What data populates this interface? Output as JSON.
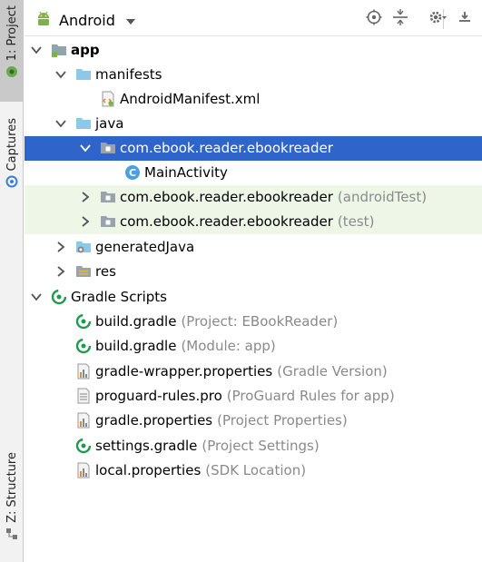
{
  "side_tabs": [
    {
      "label": "1: Project",
      "icon": "project-icon"
    },
    {
      "label": "Captures",
      "icon": "captures-icon"
    },
    {
      "label": "Z: Structure",
      "icon": "structure-icon"
    }
  ],
  "toolbar": {
    "view_label": "Android",
    "view_icon": "android-icon",
    "buttons": [
      "scroll-from-source-icon",
      "collapse-all-icon",
      "settings-icon",
      "hide-icon"
    ]
  },
  "tree": [
    {
      "label": "app",
      "bold": true,
      "hint": "",
      "icon": "module-folder-icon",
      "expanded": true
    },
    {
      "label": "manifests",
      "hint": "",
      "icon": "folder-icon",
      "expanded": true
    },
    {
      "label": "AndroidManifest.xml",
      "hint": "",
      "icon": "manifest-file-icon"
    },
    {
      "label": "java",
      "hint": "",
      "icon": "folder-icon",
      "expanded": true
    },
    {
      "label": "com.ebook.reader.ebookreader",
      "hint": "",
      "icon": "package-icon",
      "expanded": true,
      "selected": true
    },
    {
      "label": "MainActivity",
      "hint": "",
      "icon": "class-icon"
    },
    {
      "label": "com.ebook.reader.ebookreader",
      "hint": "(androidTest)",
      "icon": "package-icon",
      "expanded": false
    },
    {
      "label": "com.ebook.reader.ebookreader",
      "hint": "(test)",
      "icon": "package-icon",
      "expanded": false
    },
    {
      "label": "generatedJava",
      "hint": "",
      "icon": "generated-folder-icon",
      "expanded": false
    },
    {
      "label": "res",
      "hint": "",
      "icon": "res-folder-icon",
      "expanded": false
    },
    {
      "label": "Gradle Scripts",
      "hint": "",
      "icon": "gradle-icon",
      "expanded": true
    },
    {
      "label": "build.gradle",
      "hint": "(Project: EBookReader)",
      "icon": "gradle-file-icon"
    },
    {
      "label": "build.gradle",
      "hint": "(Module: app)",
      "icon": "gradle-file-icon"
    },
    {
      "label": "gradle-wrapper.properties",
      "hint": "(Gradle Version)",
      "icon": "properties-file-icon"
    },
    {
      "label": "proguard-rules.pro",
      "hint": "(ProGuard Rules for app)",
      "icon": "text-file-icon"
    },
    {
      "label": "gradle.properties",
      "hint": "(Project Properties)",
      "icon": "properties-file-icon"
    },
    {
      "label": "settings.gradle",
      "hint": "(Project Settings)",
      "icon": "gradle-file-icon"
    },
    {
      "label": "local.properties",
      "hint": "(SDK Location)",
      "icon": "properties-file-icon"
    }
  ]
}
